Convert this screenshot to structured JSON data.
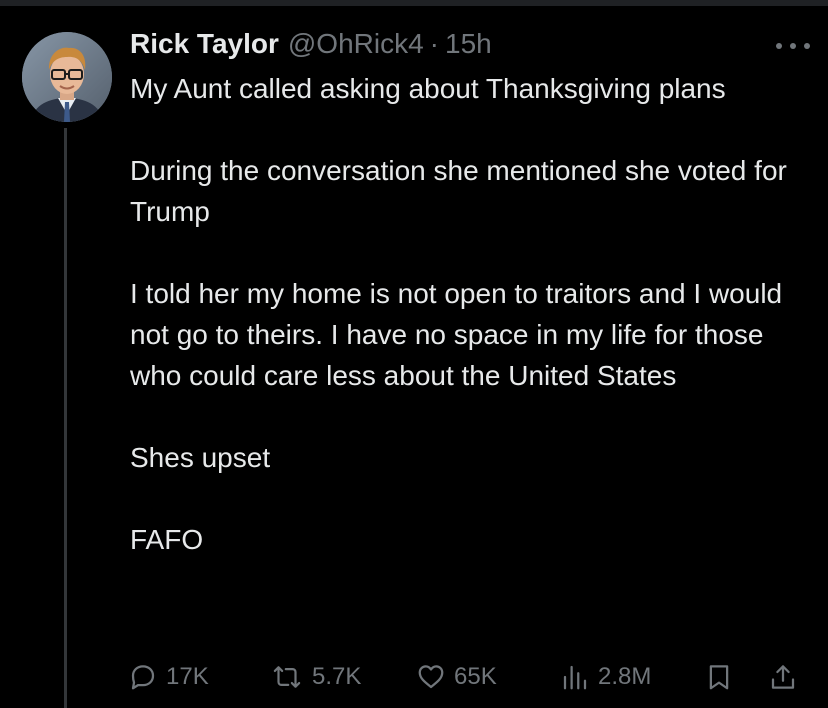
{
  "tweet": {
    "author": {
      "display_name": "Rick Taylor",
      "handle": "@OhRick4",
      "separator": "·",
      "timestamp": "15h",
      "avatar_icon": "profile-photo"
    },
    "paragraphs": [
      "My Aunt called asking about Thanksgiving plans",
      "During the conversation she mentioned she voted for Trump",
      "I told her my home is not open to traitors and I would not go to theirs. I have no space in my life for those who could care less about the United States",
      "Shes upset",
      "FAFO"
    ],
    "actions": {
      "replies": "17K",
      "reposts": "5.7K",
      "likes": "65K",
      "views": "2.8M"
    }
  },
  "icons": {
    "more": "more-horizontal-icon",
    "reply": "reply-bubble-icon",
    "repost": "repost-arrows-icon",
    "like": "heart-icon",
    "views": "bar-chart-icon",
    "bookmark": "bookmark-icon",
    "share": "share-upload-icon"
  },
  "colors": {
    "background": "#000000",
    "text_primary": "#e7e9ea",
    "text_secondary": "#71767b",
    "thread_line": "#333639"
  }
}
